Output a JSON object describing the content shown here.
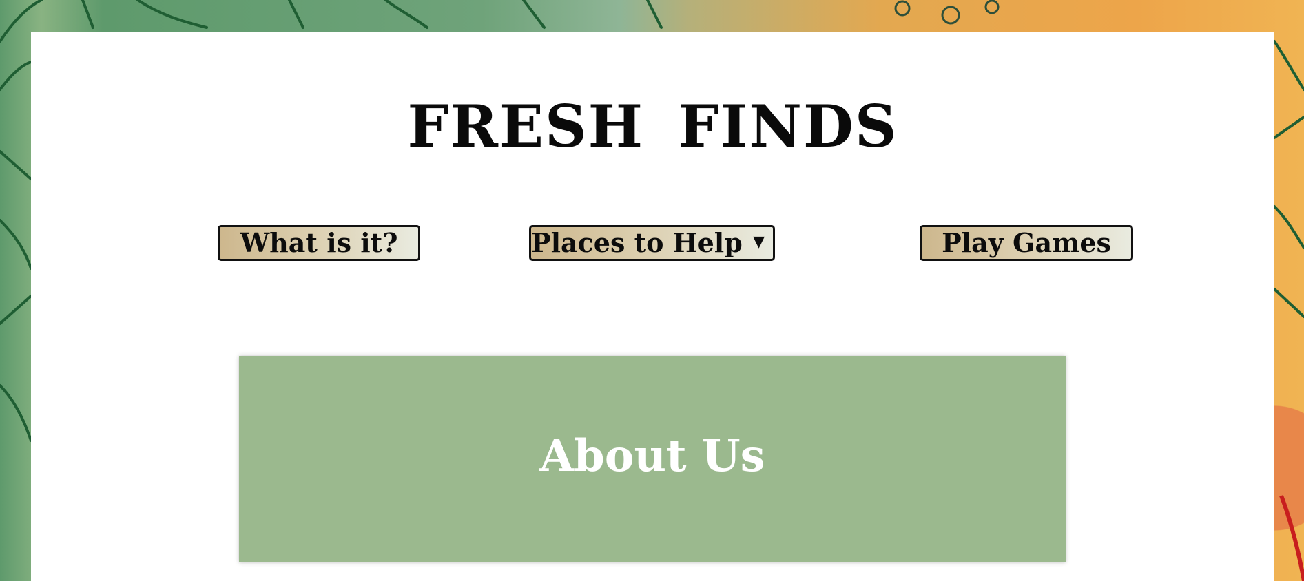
{
  "site": {
    "title": "FRESH FINDS"
  },
  "nav": {
    "what_label": "What is it?",
    "places_label": "Places to Help",
    "places_caret": "▼",
    "play_label": "Play Games"
  },
  "about": {
    "heading": "About Us"
  },
  "colors": {
    "card_green": "#9bb98e",
    "button_gradient_start": "#cdb78d",
    "button_gradient_end": "#e9ebe0",
    "panel": "#ffffff"
  }
}
